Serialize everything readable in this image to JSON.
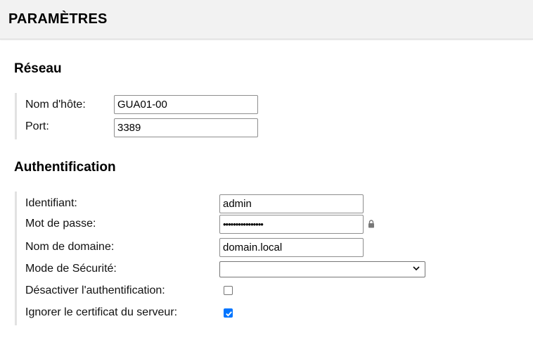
{
  "header": {
    "title": "PARAMÈTRES"
  },
  "network": {
    "title": "Réseau",
    "hostname": {
      "label": "Nom d'hôte:",
      "value": "GUA01-00"
    },
    "port": {
      "label": "Port:",
      "value": "3389"
    }
  },
  "auth": {
    "title": "Authentification",
    "username": {
      "label": "Identifiant:",
      "value": "admin"
    },
    "password": {
      "label": "Mot de passe:",
      "value": "••••••••••••••••"
    },
    "domain": {
      "label": "Nom de domaine:",
      "value": "domain.local"
    },
    "security_mode": {
      "label": "Mode de Sécurité:",
      "value": ""
    },
    "disable_auth": {
      "label": "Désactiver l'authentification:",
      "checked": false
    },
    "ignore_cert": {
      "label": "Ignorer le certificat du serveur:",
      "checked": true
    }
  },
  "colors": {
    "checkbox_accent": "#0075ff",
    "header_bg": "#f2f2f2",
    "section_rule": "#e2e2e2"
  },
  "icons": {
    "password_lock": "lock-icon",
    "select_arrow": "chevron-down-icon",
    "checkmark": "checkmark-icon"
  }
}
